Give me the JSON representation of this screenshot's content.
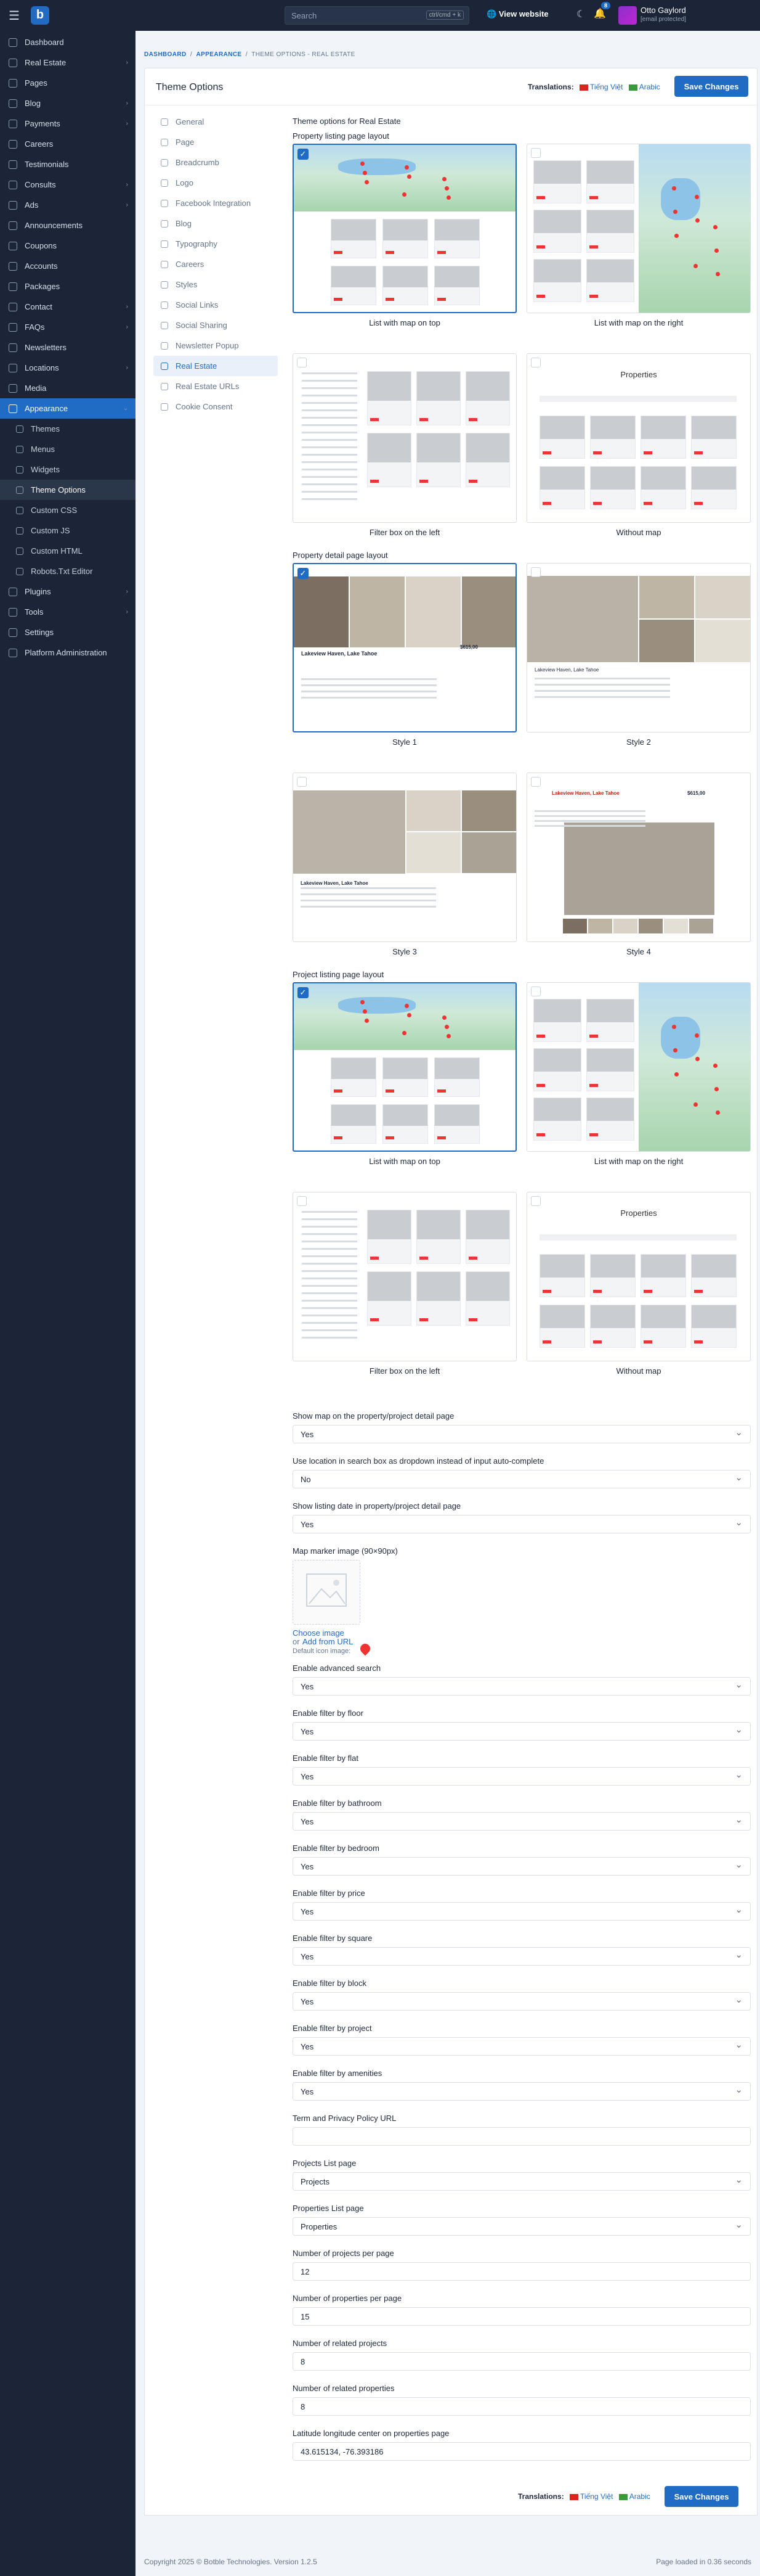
{
  "topbar": {
    "search_placeholder": "Search",
    "search_shortcut": "ctrl/cmd + k",
    "view_website": "View website",
    "notification_count": "8",
    "user_name": "Otto Gaylord",
    "user_email": "[email protected]"
  },
  "sidebar": {
    "items": [
      {
        "label": "Dashboard",
        "icon": "home-icon"
      },
      {
        "label": "Real Estate",
        "icon": "building-icon",
        "chevron": "›"
      },
      {
        "label": "Pages",
        "icon": "page-icon"
      },
      {
        "label": "Blog",
        "icon": "article-icon",
        "chevron": "›"
      },
      {
        "label": "Payments",
        "icon": "cash-icon",
        "chevron": "›"
      },
      {
        "label": "Careers",
        "icon": "briefcase-icon"
      },
      {
        "label": "Testimonials",
        "icon": "quote-icon"
      },
      {
        "label": "Consults",
        "icon": "help-icon",
        "chevron": "›"
      },
      {
        "label": "Ads",
        "icon": "ad-icon",
        "chevron": "›"
      },
      {
        "label": "Announcements",
        "icon": "speaker-icon"
      },
      {
        "label": "Coupons",
        "icon": "discount-icon"
      },
      {
        "label": "Accounts",
        "icon": "users-icon"
      },
      {
        "label": "Packages",
        "icon": "package-icon"
      },
      {
        "label": "Contact",
        "icon": "mail-icon",
        "chevron": "›"
      },
      {
        "label": "FAQs",
        "icon": "question-icon",
        "chevron": "›"
      },
      {
        "label": "Newsletters",
        "icon": "newsletter-icon"
      },
      {
        "label": "Locations",
        "icon": "map-pin-icon",
        "chevron": "›"
      },
      {
        "label": "Media",
        "icon": "folder-icon"
      },
      {
        "label": "Appearance",
        "icon": "brush-icon",
        "chevron": "⌄",
        "active": true
      }
    ],
    "appearance_sub": [
      {
        "label": "Themes"
      },
      {
        "label": "Menus"
      },
      {
        "label": "Widgets"
      },
      {
        "label": "Theme Options",
        "current": true
      },
      {
        "label": "Custom CSS"
      },
      {
        "label": "Custom JS"
      },
      {
        "label": "Custom HTML"
      },
      {
        "label": "Robots.Txt Editor"
      }
    ],
    "bottom_items": [
      {
        "label": "Plugins",
        "icon": "plug-icon",
        "chevron": "›"
      },
      {
        "label": "Tools",
        "icon": "tool-icon",
        "chevron": "›"
      },
      {
        "label": "Settings",
        "icon": "settings-icon"
      },
      {
        "label": "Platform Administration",
        "icon": "admin-icon"
      }
    ]
  },
  "breadcrumb": {
    "items": [
      "DASHBOARD",
      "APPEARANCE",
      "THEME OPTIONS - REAL ESTATE"
    ],
    "separator": "/"
  },
  "card": {
    "title": "Theme Options",
    "translations_label": "Translations:",
    "lang_1": "Tiếng Việt",
    "lang_2": "Arabic",
    "save_label": "Save Changes"
  },
  "tabs": [
    "General",
    "Page",
    "Breadcrumb",
    "Logo",
    "Facebook Integration",
    "Blog",
    "Typography",
    "Careers",
    "Styles",
    "Social Links",
    "Social Sharing",
    "Newsletter Popup",
    "Real Estate",
    "Real Estate URLs",
    "Cookie Consent"
  ],
  "active_tab": "Real Estate",
  "content": {
    "heading": "Theme options for Real Estate",
    "property_listing": {
      "label": "Property listing page layout",
      "options": [
        "List with map on top",
        "List with map on the right",
        "Filter box on the left",
        "Without map"
      ],
      "selected": "List with map on top"
    },
    "property_detail": {
      "label": "Property detail page layout",
      "options": [
        "Style 1",
        "Style 2",
        "Style 3",
        "Style 4"
      ],
      "selected": "Style 1",
      "sample_title": "Lakeview Haven, Lake Tahoe",
      "sample_price": "$615,00"
    },
    "project_listing": {
      "label": "Project listing page layout",
      "options": [
        "List with map on top",
        "List with map on the right",
        "Filter box on the left",
        "Without map"
      ],
      "selected": "List with map on top"
    },
    "properties_thumb_heading": "Properties",
    "fields": [
      {
        "label": "Show map on the property/project detail page",
        "value": "Yes"
      },
      {
        "label": "Use location in search box as dropdown instead of input auto-complete",
        "value": "No"
      },
      {
        "label": "Show listing date in property/project detail page",
        "value": "Yes"
      }
    ],
    "marker": {
      "label": "Map marker image (90×90px)",
      "choose": "Choose image",
      "or": "or",
      "add_url": "Add from URL",
      "default_label": "Default icon image:"
    },
    "fields2": [
      {
        "label": "Enable advanced search",
        "value": "Yes"
      },
      {
        "label": "Enable filter by floor",
        "value": "Yes"
      },
      {
        "label": "Enable filter by flat",
        "value": "Yes"
      },
      {
        "label": "Enable filter by bathroom",
        "value": "Yes"
      },
      {
        "label": "Enable filter by bedroom",
        "value": "Yes"
      },
      {
        "label": "Enable filter by price",
        "value": "Yes"
      },
      {
        "label": "Enable filter by square",
        "value": "Yes"
      },
      {
        "label": "Enable filter by block",
        "value": "Yes"
      },
      {
        "label": "Enable filter by project",
        "value": "Yes"
      },
      {
        "label": "Enable filter by amenities",
        "value": "Yes"
      }
    ],
    "fields3": [
      {
        "label": "Term and Privacy Policy URL",
        "value": "",
        "kind": "input"
      },
      {
        "label": "Projects List page",
        "value": "Projects",
        "kind": "select"
      },
      {
        "label": "Properties List page",
        "value": "Properties",
        "kind": "select"
      },
      {
        "label": "Number of projects per page",
        "value": "12",
        "kind": "input"
      },
      {
        "label": "Number of properties per page",
        "value": "15",
        "kind": "input"
      },
      {
        "label": "Number of related projects",
        "value": "8",
        "kind": "input"
      },
      {
        "label": "Number of related properties",
        "value": "8",
        "kind": "input"
      },
      {
        "label": "Latitude longitude center on properties page",
        "value": "43.615134, -76.393186",
        "kind": "input"
      }
    ]
  },
  "footer": {
    "copyright": "Copyright 2025 © Botble Technologies. Version 1.2.5",
    "page_loaded": "Page loaded in 0.36 seconds"
  },
  "colors": {
    "primary": "#206bc4",
    "sidebar": "#1b2537",
    "danger": "#e33333"
  }
}
